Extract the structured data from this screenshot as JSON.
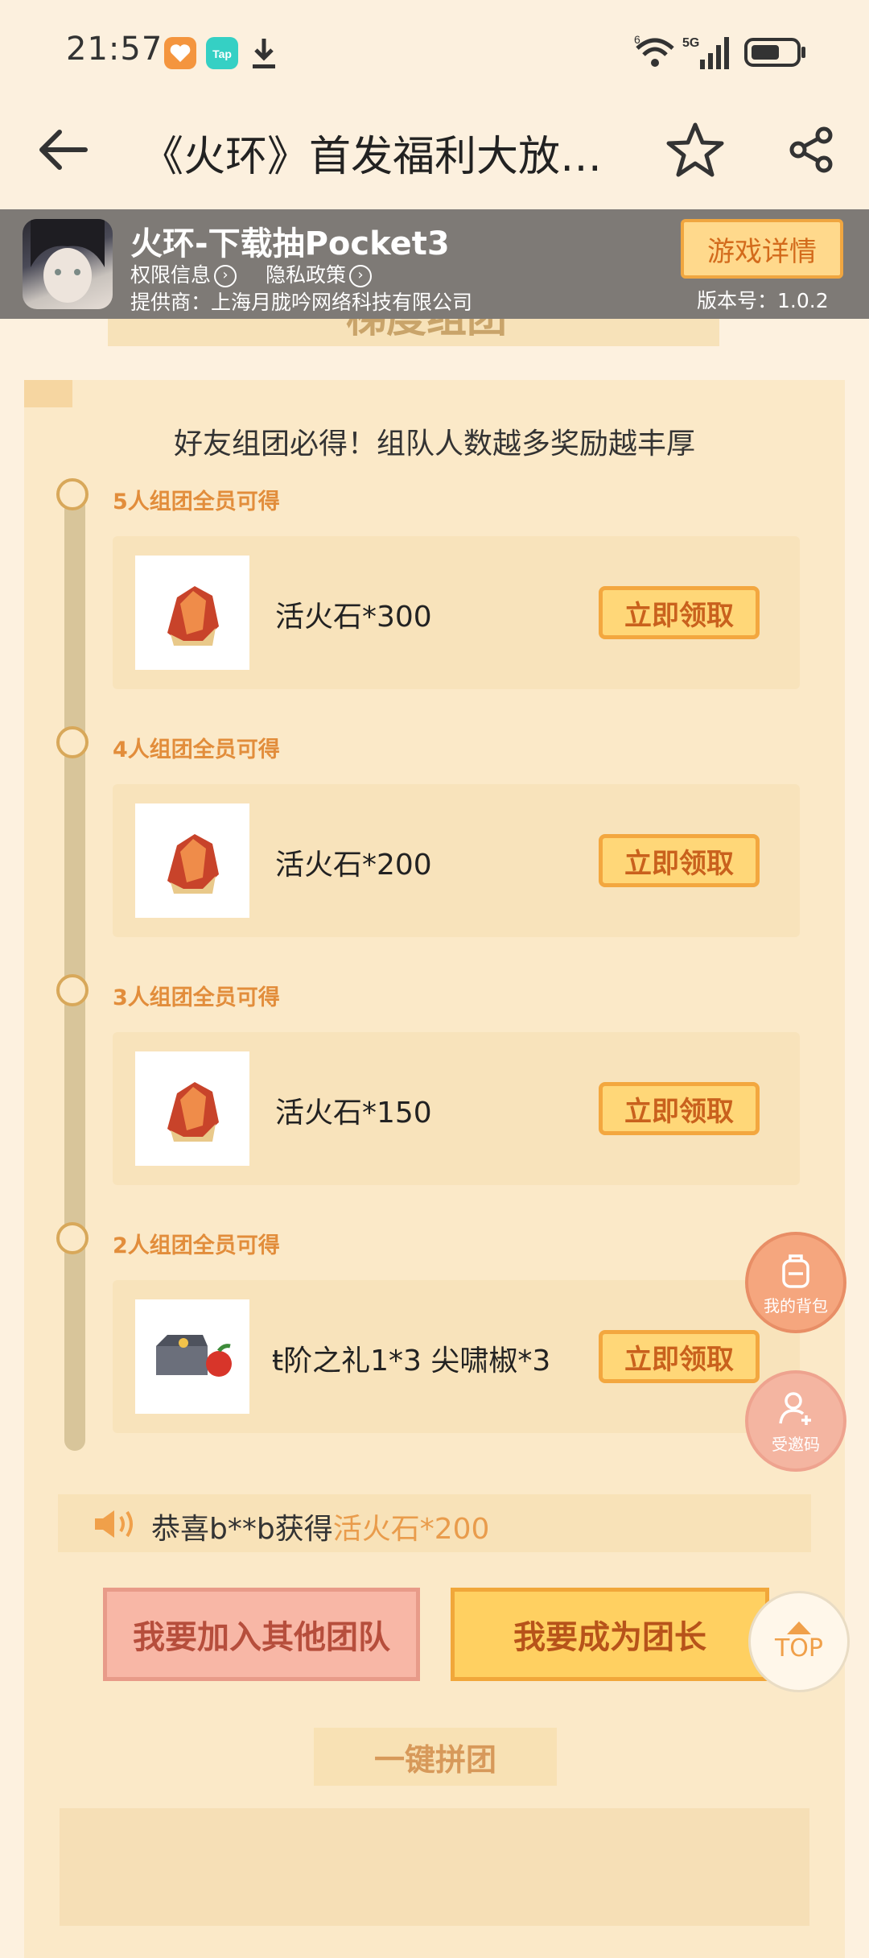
{
  "status_bar": {
    "time": "21:57",
    "network": "5G",
    "wifi_badge": "6"
  },
  "header": {
    "title": "《火环》首发福利大放…"
  },
  "game": {
    "title": "火环-下载抽Pocket3",
    "permissions": "权限信息",
    "privacy": "隐私政策",
    "provider": "提供商：上海月胧吟网络科技有限公司",
    "detail_button": "游戏详情",
    "version": "版本号：1.0.2"
  },
  "section": {
    "title": "梯度组团"
  },
  "intro": "好友组团必得！组队人数越多奖励越丰厚",
  "tiers": [
    {
      "label": "5人组团全员可得",
      "item": "活火石*300",
      "button": "立即领取"
    },
    {
      "label": "4人组团全员可得",
      "item": "活火石*200",
      "button": "立即领取"
    },
    {
      "label": "3人组团全员可得",
      "item": "活火石*150",
      "button": "立即领取"
    },
    {
      "label": "2人组团全员可得",
      "item": "ŧ阶之礼1*3   尖啸椒*3",
      "button": "立即领取"
    }
  ],
  "ticker": {
    "prefix": "恭喜b**b获得",
    "highlight": "活火石*200"
  },
  "actions": {
    "join": "我要加入其他团队",
    "leader": "我要成为团长",
    "quick": "一键拼团"
  },
  "floating": {
    "bag": "我的背包",
    "invite": "受邀码",
    "top": "TOP"
  },
  "colors": {
    "accent": "#f3a73f",
    "background": "#fdf1df",
    "panel": "#fbe9c8"
  }
}
